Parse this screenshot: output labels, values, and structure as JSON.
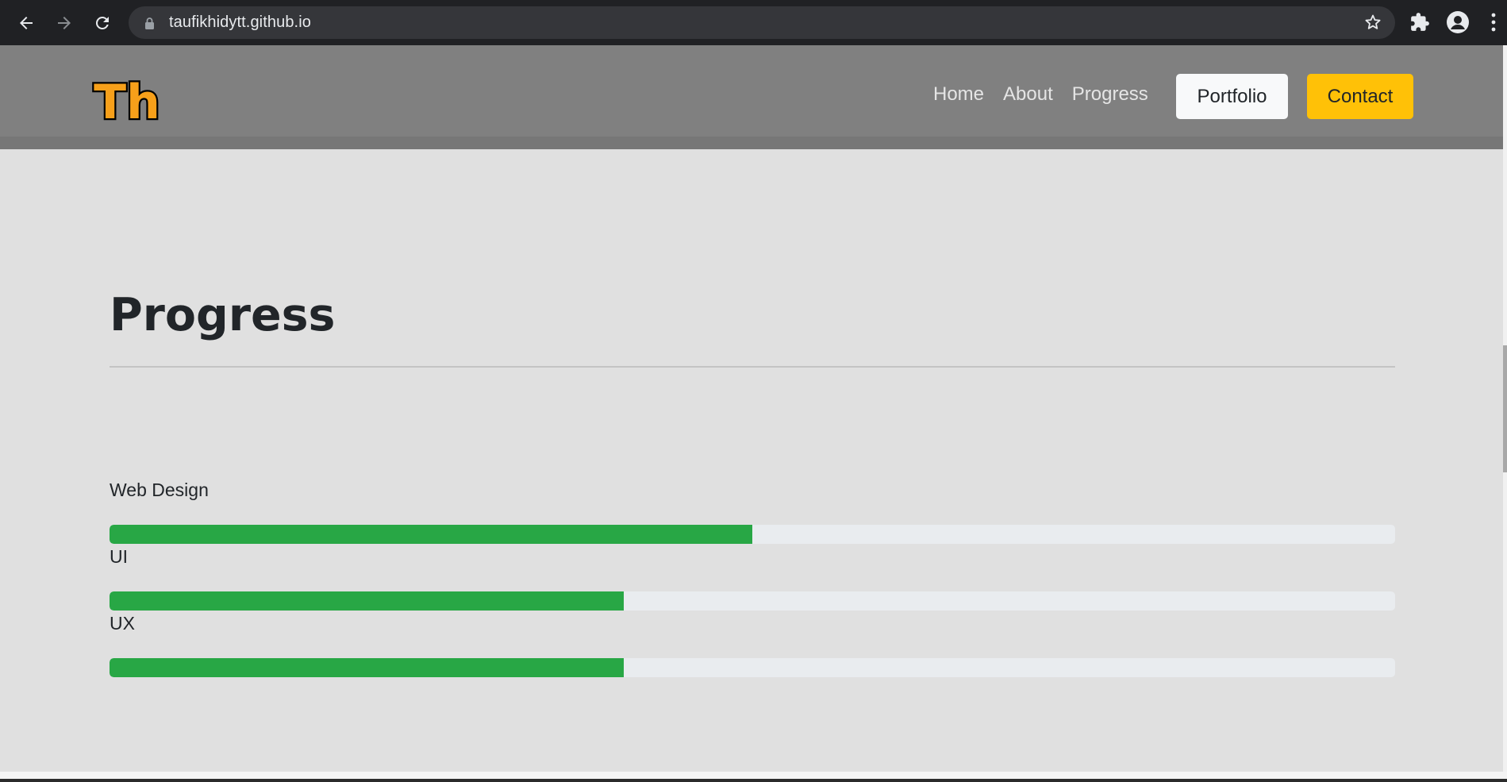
{
  "browser": {
    "url": "taufikhidytt.github.io",
    "icons": {
      "back": "arrow-left-icon",
      "forward": "arrow-right-icon",
      "reload": "reload-icon",
      "lock": "lock-icon",
      "bookmark": "star-icon",
      "extensions": "puzzle-icon",
      "profile": "profile-icon",
      "menu": "kebab-menu-icon"
    }
  },
  "site": {
    "logo": {
      "text": "Th",
      "fill": "#f7a01a",
      "outline": "#000000"
    },
    "nav": {
      "links": [
        "Home",
        "About",
        "Progress"
      ],
      "portfolio_label": "Portfolio",
      "contact_label": "Contact"
    }
  },
  "section": {
    "title": "Progress",
    "skills": [
      {
        "label": "Web Design",
        "percent": 50
      },
      {
        "label": "UI",
        "percent": 40
      },
      {
        "label": "UX",
        "percent": 40
      }
    ]
  },
  "colors": {
    "browser_bg": "#202124",
    "omnibox_bg": "#35363a",
    "navbar_bg": "#808080",
    "page_bg": "#e0e0e0",
    "progress_fill": "#28a745",
    "progress_track": "#e9ecef",
    "contact_button": "#ffc107",
    "portfolio_button": "#f8f9fa"
  }
}
